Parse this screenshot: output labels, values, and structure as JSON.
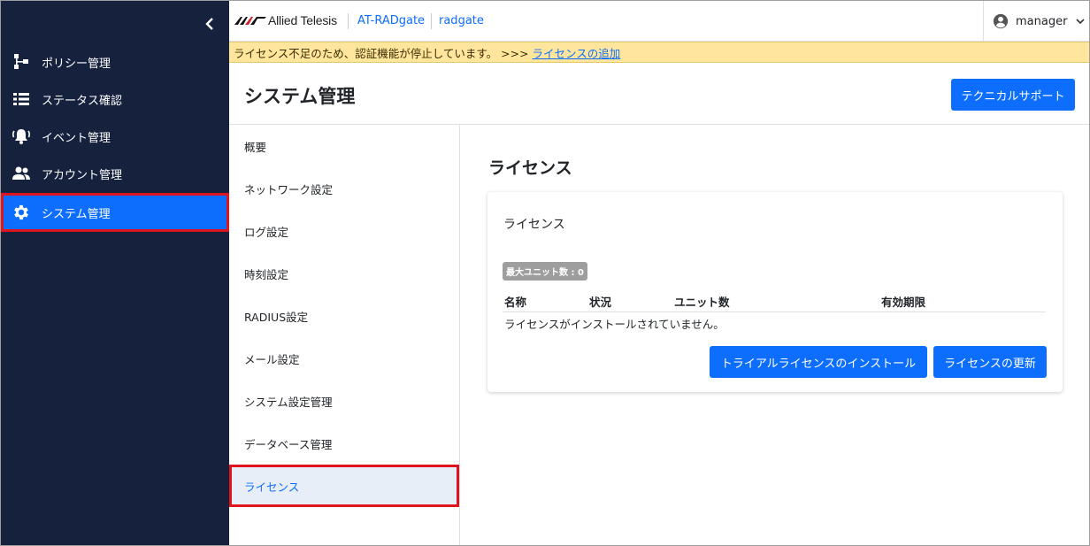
{
  "header": {
    "brand": "Allied Telesis",
    "breadcrumbs": [
      "AT-RADgate",
      "radgate"
    ],
    "user": "manager"
  },
  "sidebar": {
    "items": [
      {
        "label": "ポリシー管理",
        "icon": "policy-tree-icon"
      },
      {
        "label": "ステータス確認",
        "icon": "list-icon"
      },
      {
        "label": "イベント管理",
        "icon": "bell-icon"
      },
      {
        "label": "アカウント管理",
        "icon": "people-icon"
      },
      {
        "label": "システム管理",
        "icon": "gear-icon",
        "active": true
      }
    ]
  },
  "banner": {
    "message": "ライセンス不足のため、認証機能が停止しています。 >>>",
    "link": "ライセンスの追加"
  },
  "page": {
    "title": "システム管理",
    "support_button": "テクニカルサポート"
  },
  "subnav": {
    "items": [
      {
        "label": "概要"
      },
      {
        "label": "ネットワーク設定"
      },
      {
        "label": "ログ設定"
      },
      {
        "label": "時刻設定"
      },
      {
        "label": "RADIUS設定"
      },
      {
        "label": "メール設定"
      },
      {
        "label": "システム設定管理"
      },
      {
        "label": "データベース管理"
      },
      {
        "label": "ライセンス",
        "active": true
      }
    ]
  },
  "license": {
    "section_title": "ライセンス",
    "card_title": "ライセンス",
    "badge": "最大ユニット数 : 0",
    "columns": [
      "名称",
      "状況",
      "ユニット数",
      "有効期限"
    ],
    "empty_message": "ライセンスがインストールされていません。",
    "trial_button": "トライアルライセンスのインストール",
    "update_button": "ライセンスの更新"
  },
  "colors": {
    "sidebar_bg": "#16213d",
    "accent": "#0d6efd",
    "banner_bg": "#ffe69c",
    "highlight_border": "#e0141e"
  }
}
